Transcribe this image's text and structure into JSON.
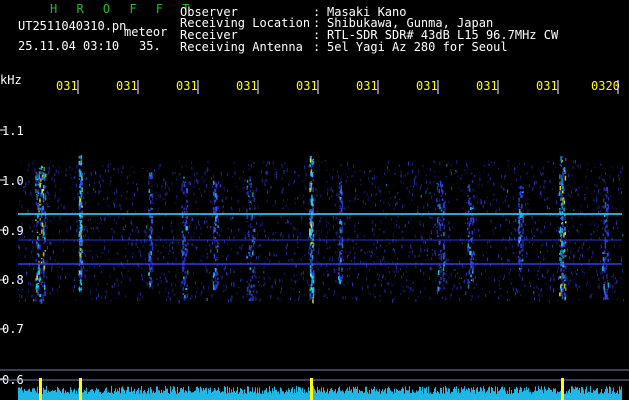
{
  "header": {
    "brand": "H R O F F T",
    "filename": "UT2511040310.pn",
    "meteor_label": "meteor",
    "datetime": "25.11.04 03:10",
    "count": "35.",
    "info": [
      {
        "label": "Observer",
        "value": "Masaki Kano"
      },
      {
        "label": "Receiving Location",
        "value": "Shibukawa, Gunma, Japan"
      },
      {
        "label": "Receiver",
        "value": "RTL-SDR SDR# 43dB L15 96.7MHz CW"
      },
      {
        "label": "Receiving Antenna",
        "value": "5el Yagi Az 280 for Seoul"
      }
    ]
  },
  "y_axis": {
    "unit": "kHz",
    "ticks": [
      "1.1",
      "1.0",
      "0.9",
      "0.8",
      "0.7",
      "0.6"
    ]
  },
  "x_axis": {
    "ticks": [
      "031",
      "031",
      "031",
      "031",
      "031",
      "031",
      "031",
      "031",
      "031",
      "0320"
    ]
  },
  "colors": {
    "background": "#000000",
    "header_brand": "#1fbf1f",
    "text": "#ffffff",
    "time_ticks": "#ffff00",
    "signal_blue": "#3344ff",
    "signal_bright": "#22ccff",
    "signal_peak": "#ffff00",
    "reference_line": "#7a7aa8",
    "histogram": "#22ccff"
  }
}
